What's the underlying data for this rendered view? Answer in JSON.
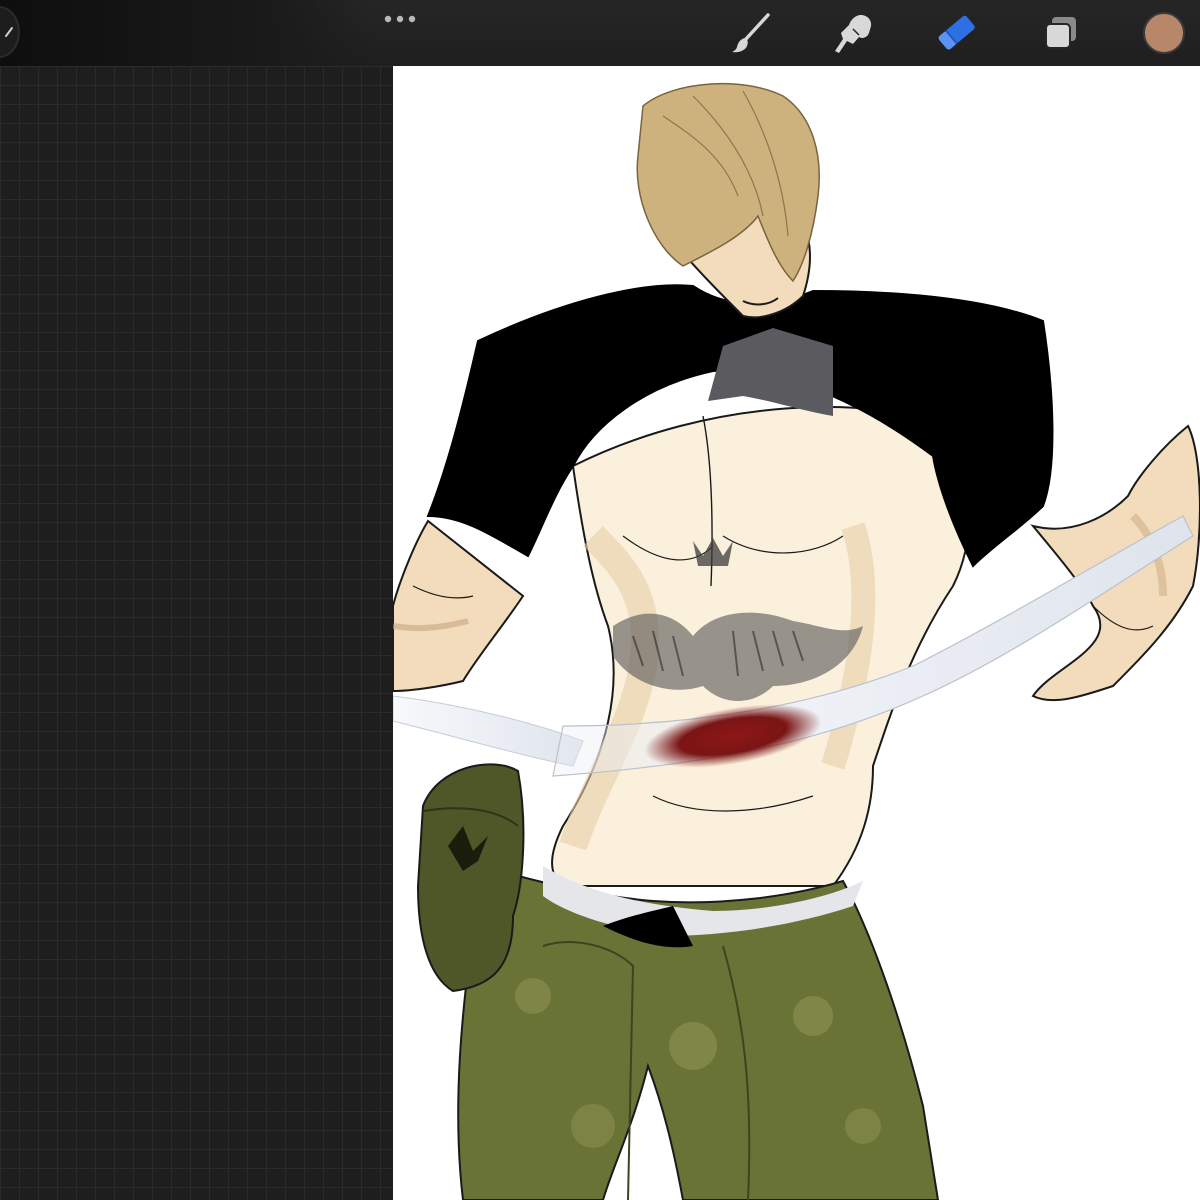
{
  "app": {
    "accent_color": "#2f6fe4",
    "icon_color": "#d8d8d8"
  },
  "toolbar": {
    "gallery_icon": "chevron-icon",
    "more_icon": "ellipsis-icon",
    "tools": [
      {
        "name": "brush",
        "icon": "paintbrush-icon",
        "active": false
      },
      {
        "name": "smudge",
        "icon": "smudge-finger-icon",
        "active": false
      },
      {
        "name": "eraser",
        "icon": "eraser-icon",
        "active": true
      },
      {
        "name": "layers",
        "icon": "layers-icon",
        "active": false
      }
    ],
    "current_color": "#b8876a"
  },
  "canvas": {
    "background": "#ffffff",
    "artwork": "figure-illustration"
  }
}
